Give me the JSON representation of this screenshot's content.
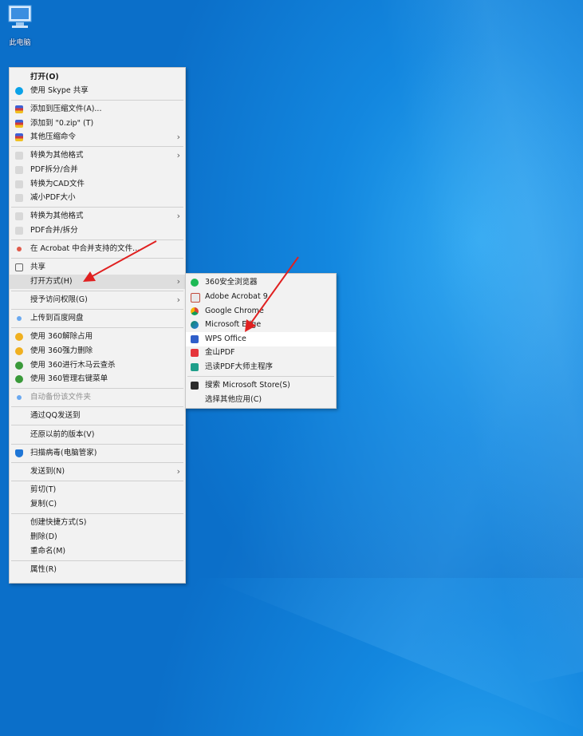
{
  "desktop": {
    "this_pc_label": "此电脑"
  },
  "context_menu": {
    "items": [
      {
        "label": "打开(O)",
        "icon": "none"
      },
      {
        "label": "使用 Skype 共享",
        "icon": "skype-icon"
      },
      {
        "label": "添加到压缩文件(A)...",
        "icon": "winrar-icon"
      },
      {
        "label": "添加到 \"0.zip\" (T)",
        "icon": "winrar-icon"
      },
      {
        "label": "其他压缩命令",
        "icon": "winrar-icon"
      },
      {
        "label": "转换为其他格式",
        "icon": "convert-icon"
      },
      {
        "label": "PDF拆分/合并",
        "icon": "pdf-split-icon"
      },
      {
        "label": "转换为CAD文件",
        "icon": "cad-icon"
      },
      {
        "label": "减小PDF大小",
        "icon": "compress-pdf-icon"
      },
      {
        "label": "转换为其他格式",
        "icon": "convert-icon"
      },
      {
        "label": "PDF合并/拆分",
        "icon": "pdf-merge-icon"
      },
      {
        "label": "在 Acrobat 中合并支持的文件...",
        "icon": "acrobat-icon"
      },
      {
        "label": "共享",
        "icon": "share-icon"
      },
      {
        "label": "打开方式(H)",
        "icon": "none"
      },
      {
        "label": "授予访问权限(G)",
        "icon": "none"
      },
      {
        "label": "上传到百度网盘",
        "icon": "baidu-cloud-icon"
      },
      {
        "label": "使用 360解除占用",
        "icon": "360-unlock-icon"
      },
      {
        "label": "使用 360强力删除",
        "icon": "360-delete-icon"
      },
      {
        "label": "使用 360进行木马云查杀",
        "icon": "360-scan-icon"
      },
      {
        "label": "使用 360管理右键菜单",
        "icon": "360-menu-icon"
      },
      {
        "label": "自动备份该文件夹",
        "icon": "backup-icon"
      },
      {
        "label": "通过QQ发送到",
        "icon": "none"
      },
      {
        "label": "还原以前的版本(V)",
        "icon": "none"
      },
      {
        "label": "扫描病毒(电脑管家)",
        "icon": "shield-icon"
      },
      {
        "label": "发送到(N)",
        "icon": "none"
      },
      {
        "label": "剪切(T)",
        "icon": "none"
      },
      {
        "label": "复制(C)",
        "icon": "none"
      },
      {
        "label": "创建快捷方式(S)",
        "icon": "none"
      },
      {
        "label": "删除(D)",
        "icon": "none"
      },
      {
        "label": "重命名(M)",
        "icon": "none"
      },
      {
        "label": "属性(R)",
        "icon": "none"
      }
    ],
    "submenu_arrow": "›"
  },
  "open_with_submenu": {
    "items": [
      {
        "label": "360安全浏览器",
        "icon": "360-browser-icon"
      },
      {
        "label": "Adobe Acrobat 9",
        "icon": "adobe-acrobat-icon"
      },
      {
        "label": "Google Chrome",
        "icon": "chrome-icon"
      },
      {
        "label": "Microsoft Edge",
        "icon": "edge-icon"
      },
      {
        "label": "WPS Office",
        "icon": "wps-icon"
      },
      {
        "label": "金山PDF",
        "icon": "kingsoft-pdf-icon"
      },
      {
        "label": "迅读PDF大师主程序",
        "icon": "xundu-pdf-icon"
      },
      {
        "label": "搜索 Microsoft Store(S)",
        "icon": "store-icon"
      },
      {
        "label": "选择其他应用(C)",
        "icon": "none"
      }
    ]
  },
  "colors": {
    "accent_arrow": "#e02020",
    "desktop_blue": "#1387df"
  }
}
